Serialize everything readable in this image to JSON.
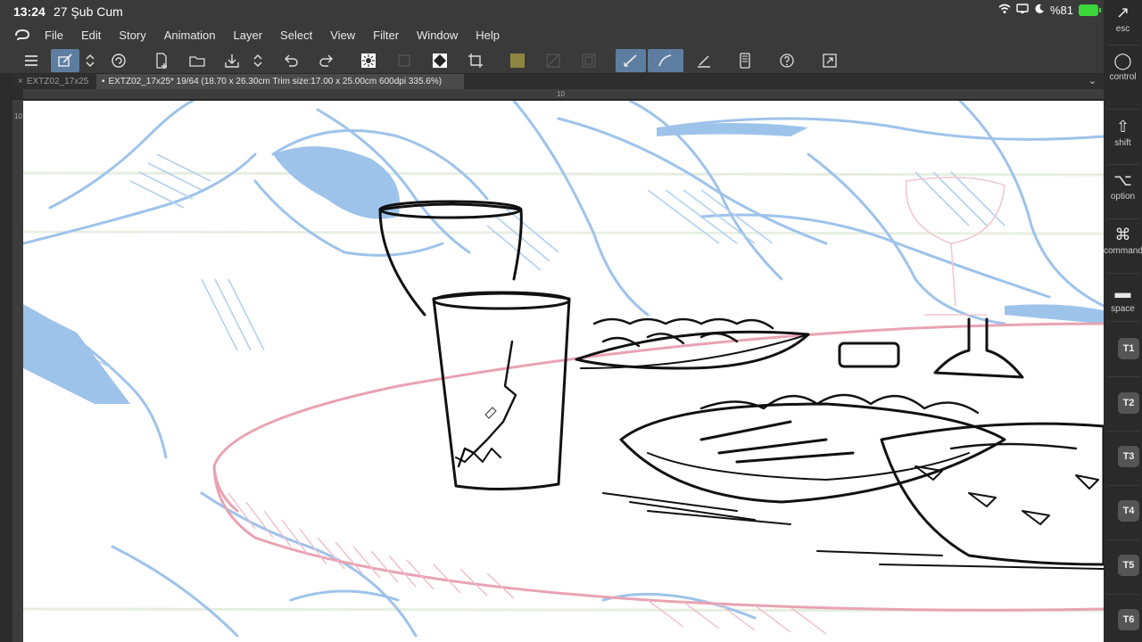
{
  "status": {
    "time": "13:24",
    "date": "27 Şub Cum",
    "battery": "%81"
  },
  "menu": [
    "File",
    "Edit",
    "Story",
    "Animation",
    "Layer",
    "Select",
    "View",
    "Filter",
    "Window",
    "Help"
  ],
  "tabs": [
    {
      "label": "EXTZ02_17x25"
    },
    {
      "label": "EXTZ02_17x25* 19/64 (18.70 x 26.30cm Trim size:17.00 x 25.00cm 600dpi 335.6%)"
    }
  ],
  "ruler": {
    "top_mark": "10",
    "left_mark": "10"
  },
  "right_panel": {
    "keys": [
      "esc",
      "control",
      "shift",
      "option",
      "command",
      "space"
    ],
    "tkeys": [
      "T1",
      "T2",
      "T3",
      "T4",
      "T5",
      "T6"
    ]
  },
  "colors": {
    "accent": "#5d7ea0",
    "sketch_blue": "#9ec3ea",
    "sketch_red": "#e8a3b3"
  }
}
